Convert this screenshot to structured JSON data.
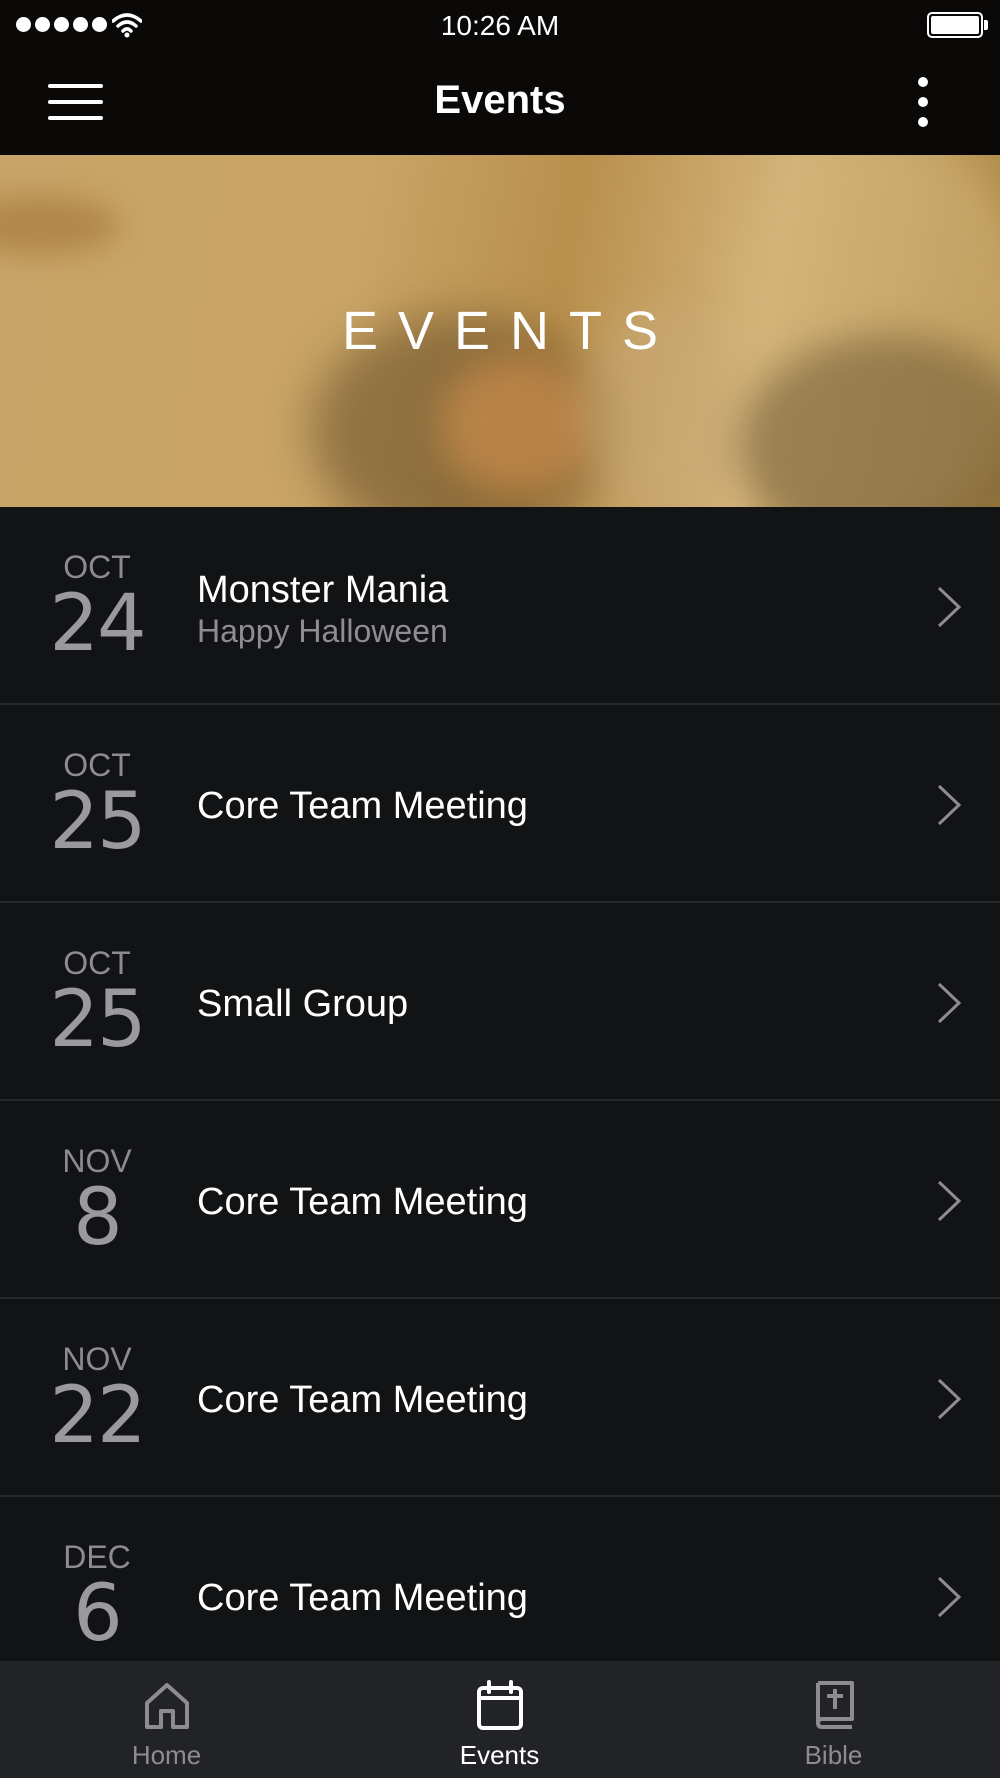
{
  "status_bar": {
    "time": "10:26 AM",
    "signal_dots": 5,
    "battery_level": 1.0
  },
  "nav": {
    "title": "Events",
    "menu_icon": "hamburger-icon",
    "more_icon": "more-vertical-icon"
  },
  "banner": {
    "title": "EVENTS"
  },
  "events": [
    {
      "month": "OCT",
      "day": "24",
      "title": "Monster Mania",
      "subtitle": "Happy Halloween"
    },
    {
      "month": "OCT",
      "day": "25",
      "title": "Core Team Meeting",
      "subtitle": ""
    },
    {
      "month": "OCT",
      "day": "25",
      "title": "Small Group",
      "subtitle": ""
    },
    {
      "month": "NOV",
      "day": "8",
      "title": "Core Team Meeting",
      "subtitle": ""
    },
    {
      "month": "NOV",
      "day": "22",
      "title": "Core Team Meeting",
      "subtitle": ""
    },
    {
      "month": "DEC",
      "day": "6",
      "title": "Core Team Meeting",
      "subtitle": ""
    }
  ],
  "tabs": [
    {
      "label": "Home",
      "icon": "home-icon",
      "active": false
    },
    {
      "label": "Events",
      "icon": "calendar-icon",
      "active": true
    },
    {
      "label": "Bible",
      "icon": "bible-icon",
      "active": false
    }
  ],
  "colors": {
    "background": "#121315",
    "bar": "#0b0908",
    "tab_bar": "#222326",
    "banner_tint": "#c9a465",
    "muted_text": "#8e8e90"
  }
}
